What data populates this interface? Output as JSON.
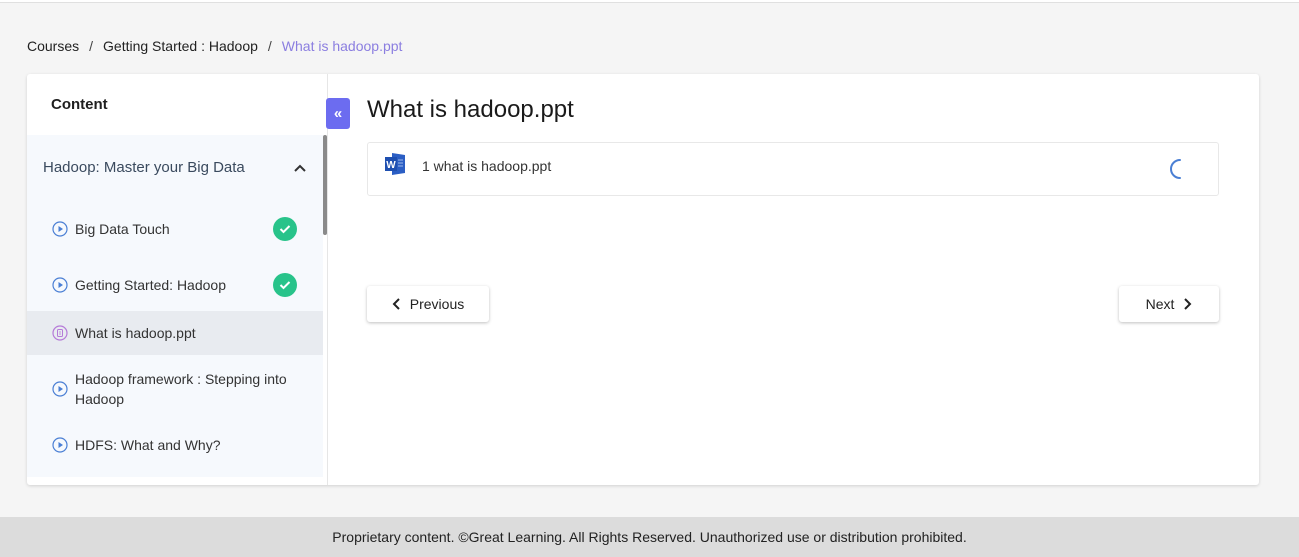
{
  "breadcrumb": {
    "items": [
      "Courses",
      "Getting Started : Hadoop"
    ],
    "separator": "/",
    "current": "What is hadoop.ppt"
  },
  "sidebar": {
    "title": "Content",
    "section": {
      "title": "Hadoop: Master your Big Data",
      "expanded": true,
      "items": [
        {
          "label": "Big Data Touch",
          "icon": "play-circle-icon",
          "completed": true
        },
        {
          "label": "Getting Started: Hadoop",
          "icon": "play-circle-icon",
          "completed": true
        },
        {
          "label": "What is hadoop.ppt",
          "icon": "document-circle-icon",
          "completed": false,
          "active": true
        },
        {
          "label": "Hadoop framework : Stepping into Hadoop",
          "icon": "play-circle-icon",
          "completed": false
        },
        {
          "label": "HDFS: What and Why?",
          "icon": "play-circle-icon",
          "completed": false
        }
      ]
    },
    "collapse_glyph": "«"
  },
  "main": {
    "title": "What is hadoop.ppt",
    "file": {
      "name": "1 what is hadoop.ppt",
      "icon": "word-document-icon",
      "status": "loading"
    },
    "previous_label": "Previous",
    "next_label": "Next"
  },
  "footer": {
    "text": "Proprietary content. ©Great Learning. All Rights Reserved. Unauthorized use or distribution prohibited."
  },
  "colors": {
    "accent": "#6c6cf0",
    "breadcrumb_current": "#8b7ee0",
    "complete": "#28c38a",
    "play_icon": "#4a7fd4",
    "doc_icon": "#b57ad8"
  }
}
